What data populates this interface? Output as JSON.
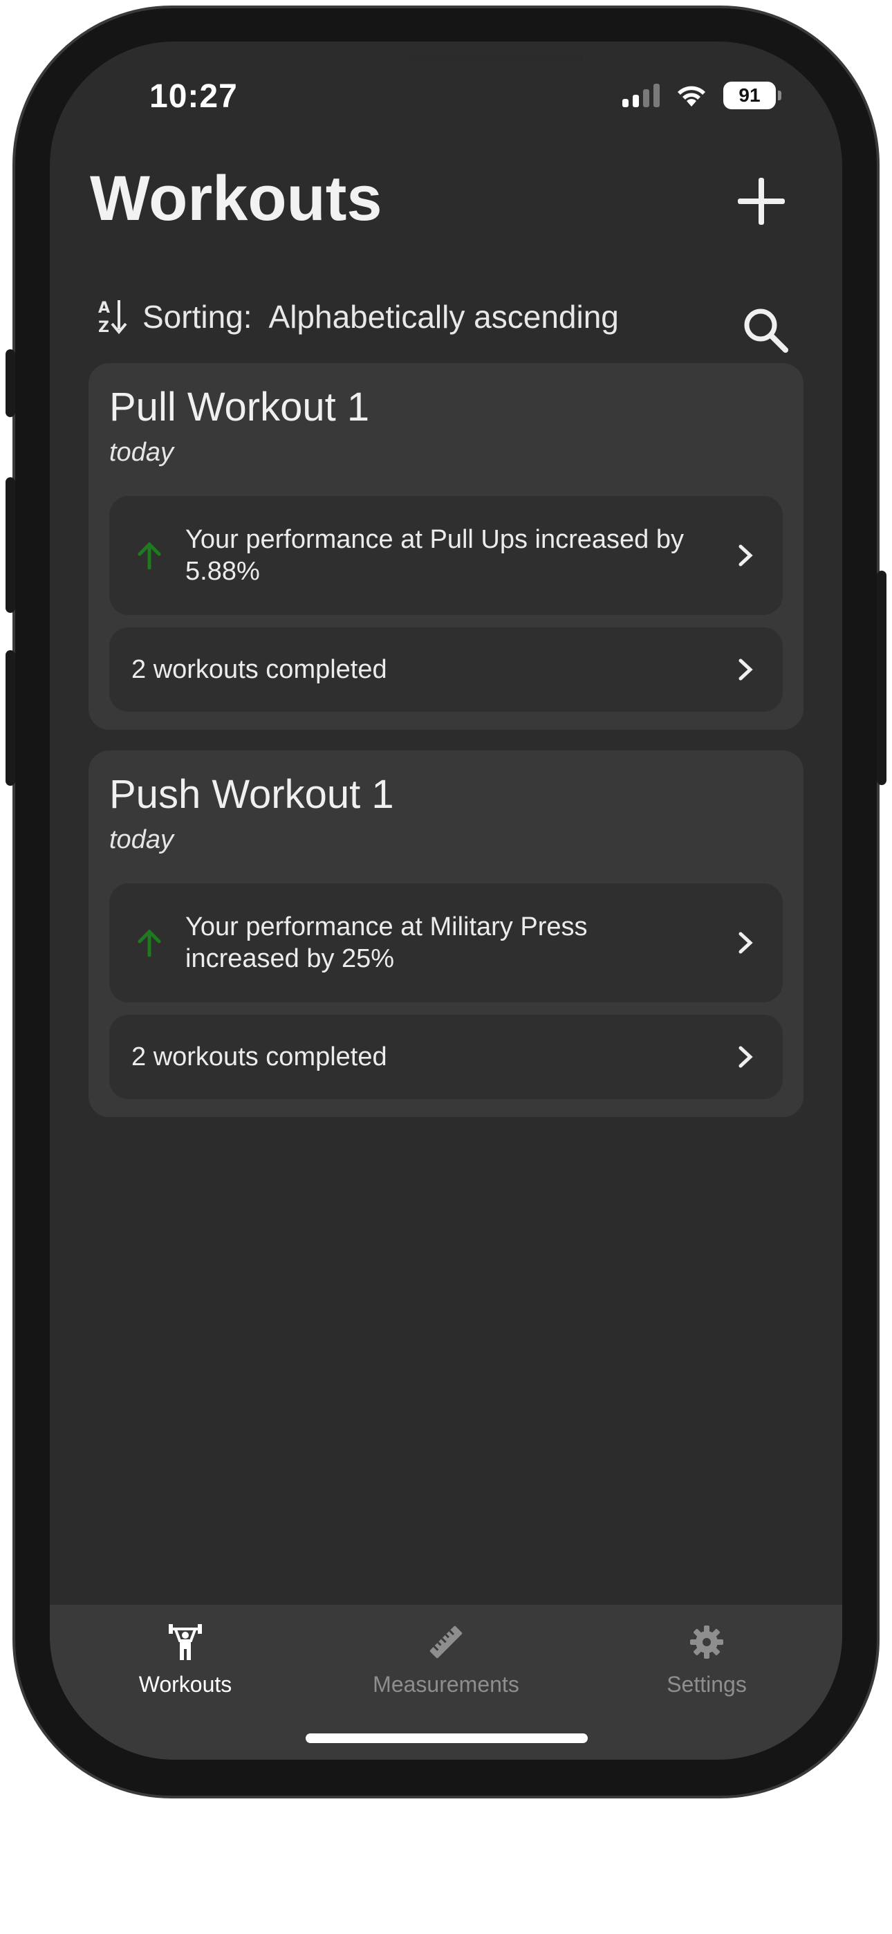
{
  "status_bar": {
    "time": "10:27",
    "battery": "91"
  },
  "header": {
    "title": "Workouts",
    "add_icon": "plus-icon",
    "sort_icon": "sort-alpha-ascending-icon",
    "sort_label": "Sorting:",
    "sort_value": "Alphabetically ascending",
    "search_icon": "search-icon"
  },
  "workouts": [
    {
      "title": "Pull Workout 1",
      "date": "today",
      "insight": "Your performance at Pull Ups increased by 5.88%",
      "completed": "2 workouts completed"
    },
    {
      "title": "Push Workout 1",
      "date": "today",
      "insight": "Your performance at Military Press increased by 25%",
      "completed": "2 workouts completed"
    }
  ],
  "tabs": [
    {
      "label": "Workouts",
      "icon": "weightlifter-icon",
      "active": true
    },
    {
      "label": "Measurements",
      "icon": "ruler-icon",
      "active": false
    },
    {
      "label": "Settings",
      "icon": "gear-icon",
      "active": false
    }
  ],
  "colors": {
    "background": "#2c2c2c",
    "card": "#393939",
    "row": "#2f2f2f",
    "trend_up": "#1f7a1f",
    "tab_active": "#ffffff",
    "tab_inactive": "#8e8e8e"
  }
}
